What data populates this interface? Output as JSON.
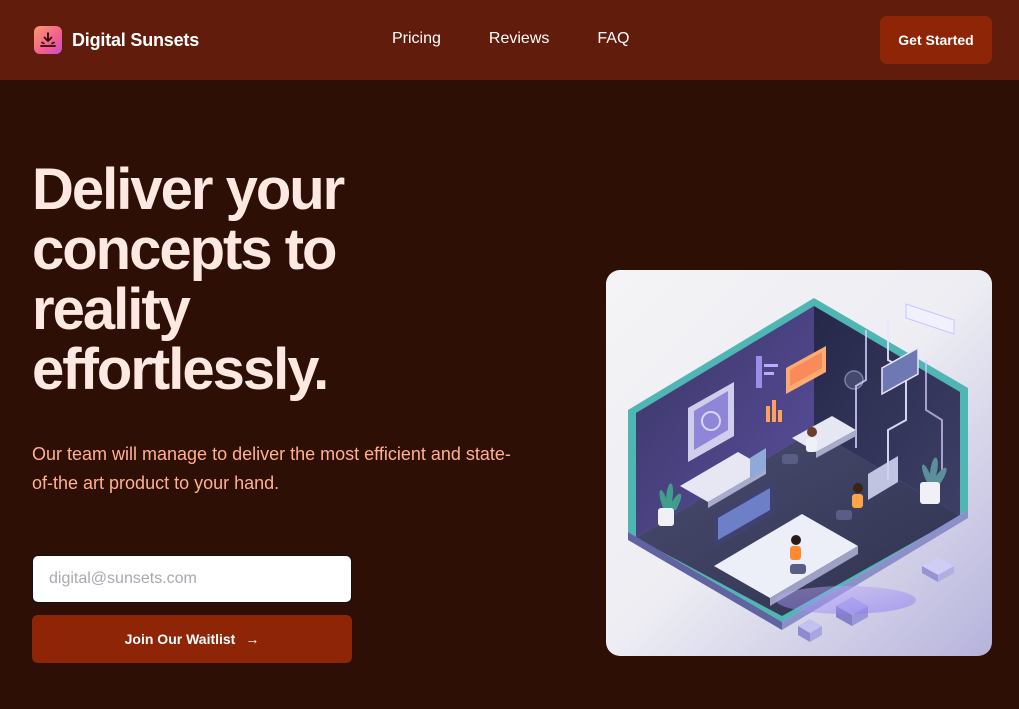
{
  "brand": {
    "name": "Digital Sunsets",
    "logo_icon": "sunset-logo-icon"
  },
  "nav": {
    "links": [
      {
        "label": "Pricing"
      },
      {
        "label": "Reviews"
      },
      {
        "label": "FAQ"
      }
    ],
    "cta_label": "Get Started"
  },
  "hero": {
    "title": "Deliver your concepts to reality effortlessly.",
    "subtitle": "Our team will manage to deliver the most efficient and state-of-the art product to your hand.",
    "email_placeholder": "digital@sunsets.com",
    "email_value": "",
    "waitlist_label": "Join Our Waitlist",
    "waitlist_arrow": "→"
  },
  "colors": {
    "page_bg": "#2e0f06",
    "nav_bg": "#611c0b",
    "accent": "#8f2507",
    "title": "#fde8e2",
    "subtitle": "#ffb08f"
  },
  "illustration": {
    "icon": "isometric-office-illustration"
  }
}
